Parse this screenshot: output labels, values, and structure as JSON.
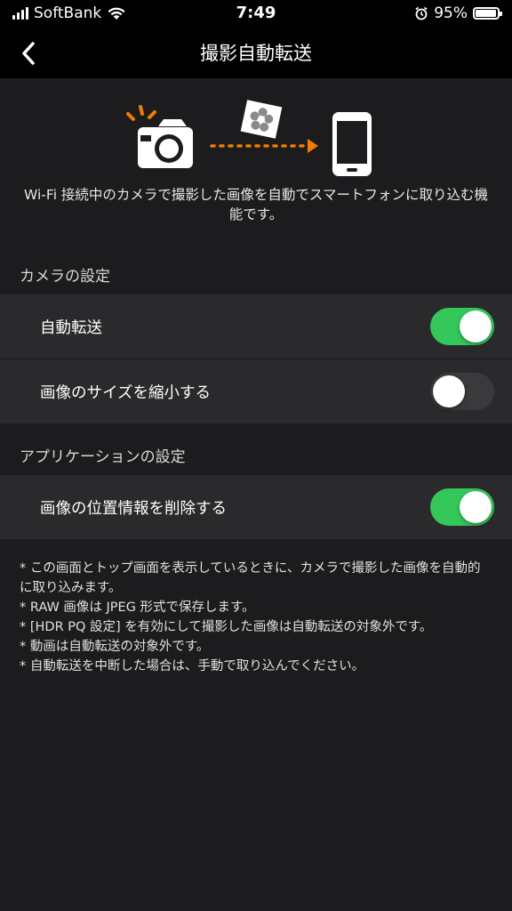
{
  "status_bar": {
    "carrier": "SoftBank",
    "time": "7:49",
    "battery_percent": "95%",
    "battery_level": 0.95
  },
  "nav": {
    "title": "撮影自動転送",
    "back_icon": "chevron-left-icon"
  },
  "illustration": {
    "camera_icon": "camera-icon",
    "photo_icon": "flower-photo-icon",
    "phone_icon": "smartphone-icon",
    "arrow_color": "#f07d00"
  },
  "description": "Wi-Fi 接続中のカメラで撮影した画像を自動でスマートフォンに取り込む機能です。",
  "sections": [
    {
      "header": "カメラの設定",
      "items": [
        {
          "label": "自動転送",
          "on": true
        },
        {
          "label": "画像のサイズを縮小する",
          "on": false
        }
      ]
    },
    {
      "header": "アプリケーションの設定",
      "items": [
        {
          "label": "画像の位置情報を削除する",
          "on": true
        }
      ]
    }
  ],
  "notes": [
    "* この画面とトップ画面を表示しているときに、カメラで撮影した画像を自動的に取り込みます。",
    "* RAW 画像は JPEG 形式で保存します。",
    "* [HDR PQ 設定] を有効にして撮影した画像は自動転送の対象外です。",
    "* 動画は自動転送の対象外です。",
    "* 自動転送を中断した場合は、手動で取り込んでください。"
  ],
  "colors": {
    "toggle_on": "#34c759",
    "toggle_off": "#3a3a3c",
    "accent_orange": "#f07d00"
  }
}
